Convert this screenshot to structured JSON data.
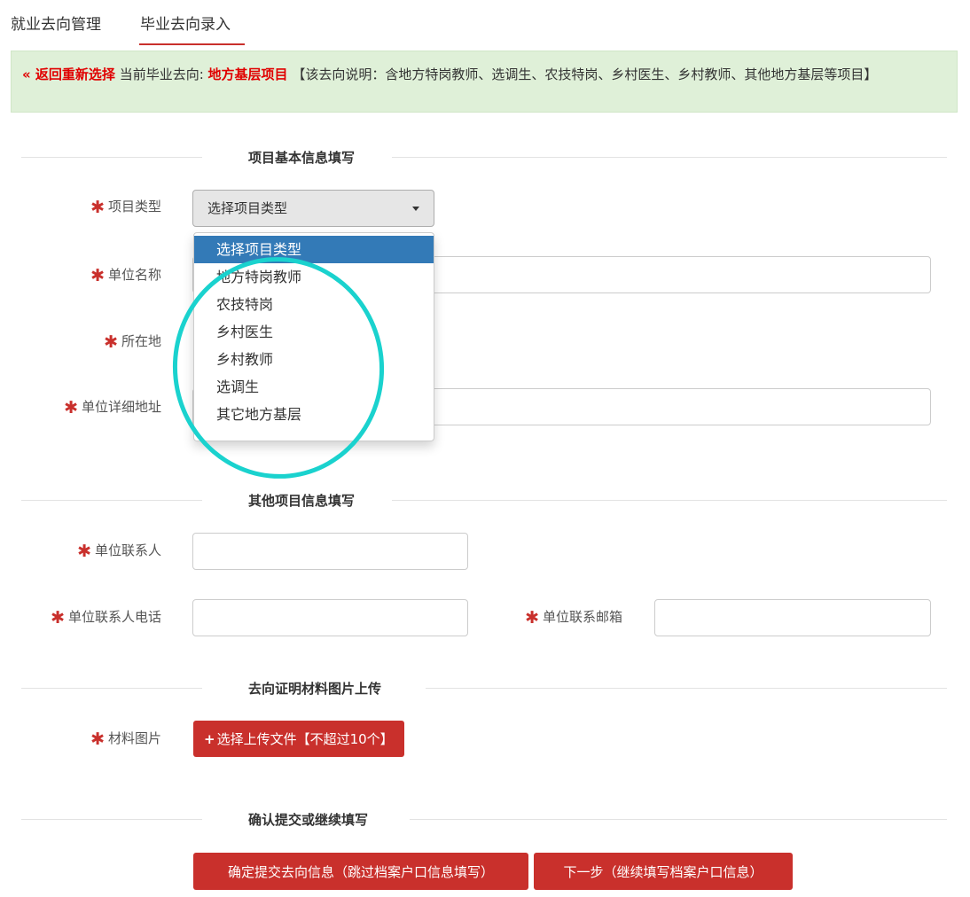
{
  "tabs": [
    {
      "label": "就业去向管理"
    },
    {
      "label": "毕业去向录入"
    }
  ],
  "alert": {
    "back_label": "« 返回重新选择",
    "current_prefix": "当前毕业去向:",
    "current_value": "地方基层项目",
    "desc": "【该去向说明：含地方特岗教师、选调生、农技特岗、乡村医生、乡村教师、其他地方基层等项目】"
  },
  "sections": {
    "basic": "项目基本信息填写",
    "other": "其他项目信息填写",
    "upload": "去向证明材料图片上传",
    "confirm": "确认提交或继续填写"
  },
  "fields": {
    "project_type": {
      "label": "项目类型",
      "selected": "选择项目类型",
      "options": [
        "选择项目类型",
        "地方特岗教师",
        "农技特岗",
        "乡村医生",
        "乡村教师",
        "选调生",
        "其它地方基层"
      ]
    },
    "unit_name": {
      "label": "单位名称",
      "value": ""
    },
    "location": {
      "label": "所在地"
    },
    "unit_address": {
      "label": "单位详细地址",
      "value": ""
    },
    "contact": {
      "label": "单位联系人",
      "value": ""
    },
    "contact_phone": {
      "label": "单位联系人电话",
      "value": ""
    },
    "contact_email": {
      "label": "单位联系邮箱",
      "value": ""
    },
    "material": {
      "label": "材料图片"
    }
  },
  "buttons": {
    "upload_icon": "+",
    "upload": "选择上传文件【不超过10个】",
    "submit": "确定提交去向信息（跳过档案户口信息填写）",
    "next": "下一步（继续填写档案户口信息）"
  },
  "required_mark": "✱",
  "icons": {
    "caret": "caret-down-icon",
    "plus": "plus-icon"
  },
  "colors": {
    "accent": "#c9302c",
    "alert_bg": "#dff0d8",
    "highlight": "#337ab7",
    "annotation": "#1ad2ce"
  }
}
